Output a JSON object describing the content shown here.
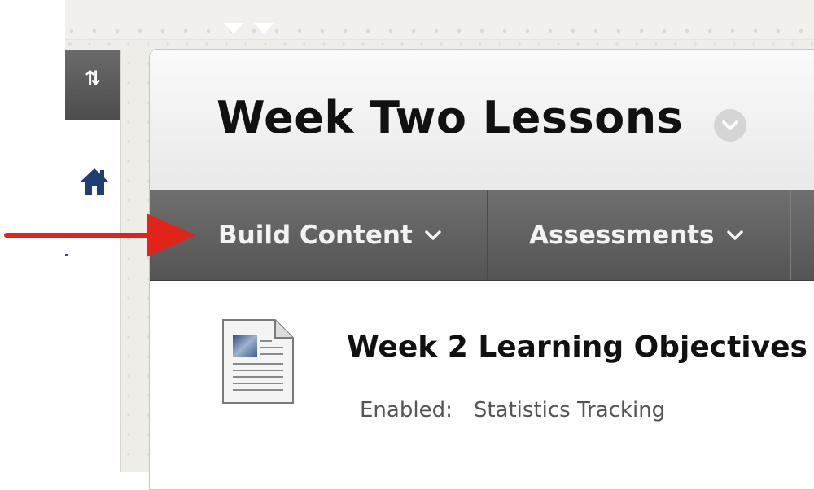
{
  "course_menu": {
    "sort_icon": "sort-arrows-icon",
    "sort_glyph": "⇅",
    "home_icon": "home-icon"
  },
  "page": {
    "title": "Week Two Lessons",
    "title_menu_icon": "chevron-down-circle-icon"
  },
  "action_bar": {
    "items": [
      {
        "label": "Build Content",
        "icon": "chevron-down-icon"
      },
      {
        "label": "Assessments",
        "icon": "chevron-down-icon"
      }
    ]
  },
  "content_item": {
    "icon": "document-icon",
    "title": "Week 2 Learning Objectives",
    "meta_label": "Enabled:",
    "meta_value": "Statistics Tracking"
  },
  "annotation": {
    "icon": "red-arrow-icon",
    "color": "#e2231a"
  },
  "colors": {
    "action_bar": "#5f5f5f",
    "home_icon": "#1f3f73",
    "annotation_arrow": "#e2231a"
  }
}
